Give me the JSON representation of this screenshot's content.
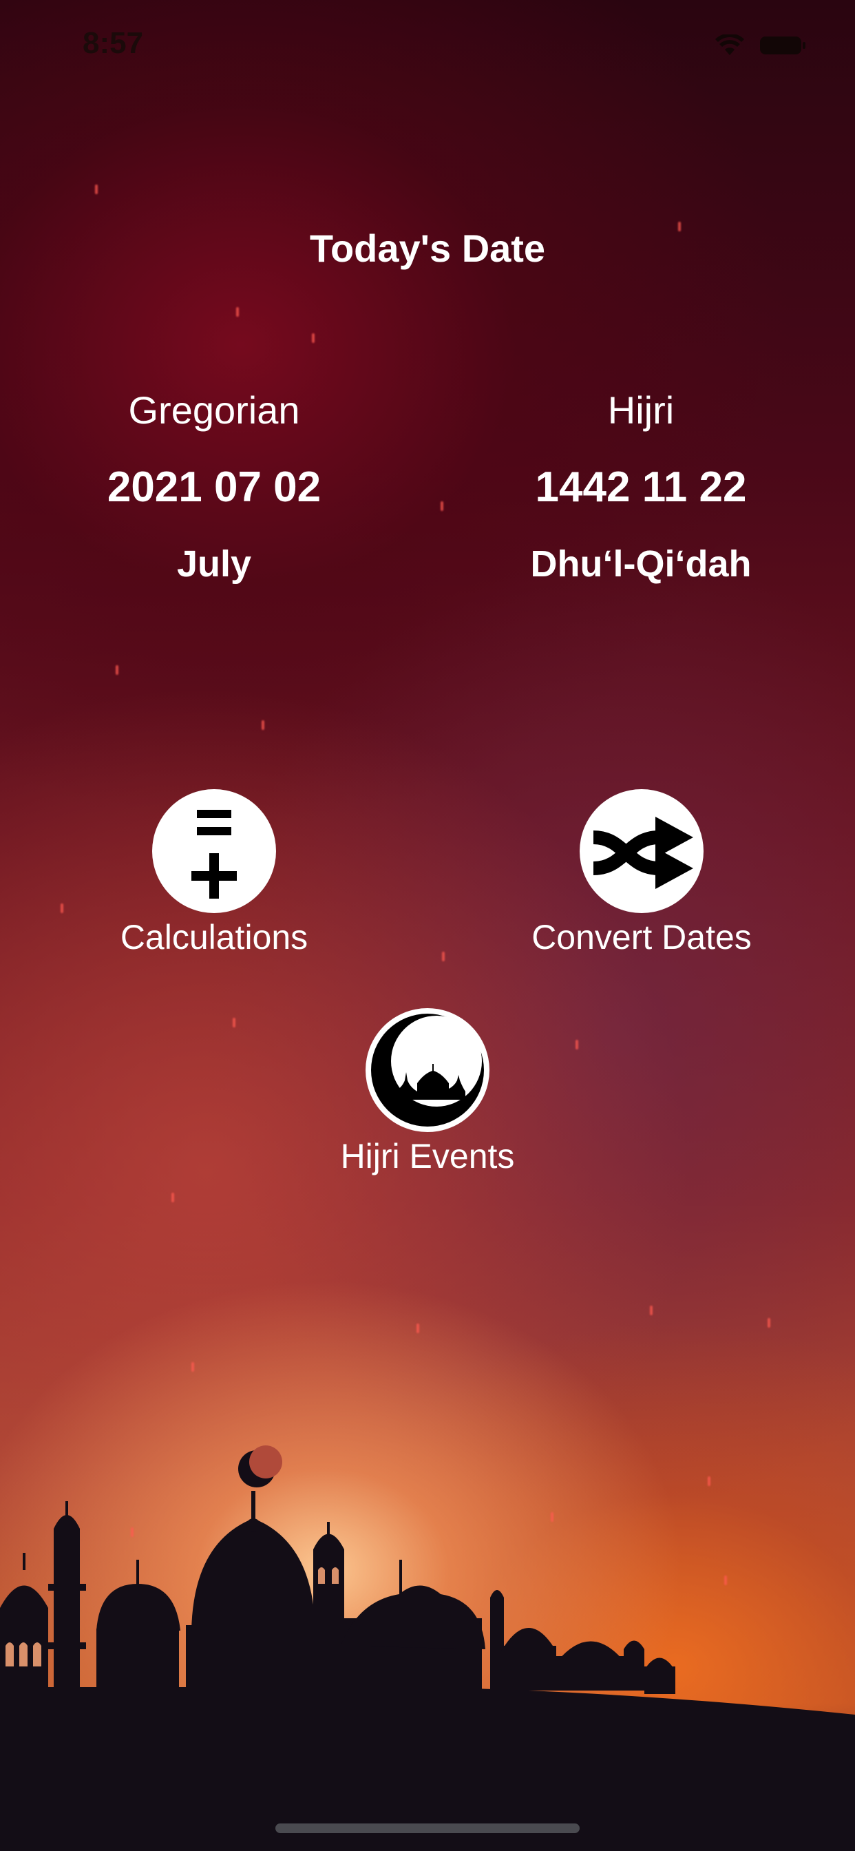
{
  "status_bar": {
    "time": "8:57"
  },
  "header": {
    "title": "Today's Date"
  },
  "gregorian": {
    "label": "Gregorian",
    "date": "2021 07 02",
    "month": "July"
  },
  "hijri": {
    "label": "Hijri",
    "date": "1442 11 22",
    "month": "Dhuʻl-Qiʻdah"
  },
  "actions": {
    "calculations": {
      "label": "Calculations",
      "icon": "equals-plus-icon"
    },
    "convert_dates": {
      "label": "Convert Dates",
      "icon": "shuffle-icon"
    },
    "hijri_events": {
      "label": "Hijri Events",
      "icon": "crescent-mosque-icon"
    }
  },
  "colors": {
    "text": "#ffffff",
    "icon_circle": "#ffffff",
    "icon_glyph": "#000000",
    "silhouette": "#130d16"
  }
}
